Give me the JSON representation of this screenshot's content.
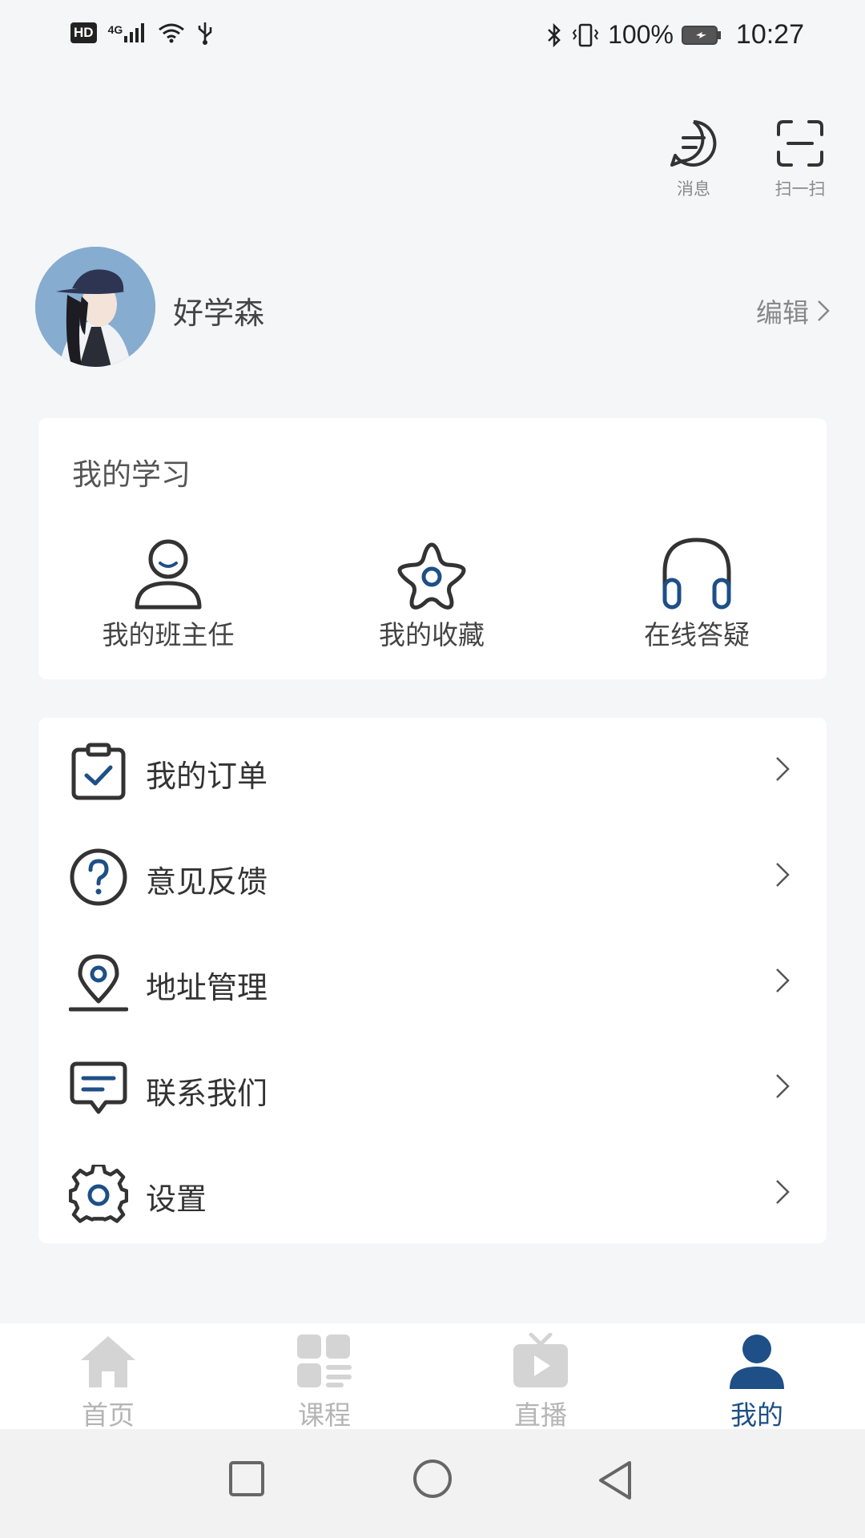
{
  "status_bar": {
    "hd": "HD",
    "network": "4G",
    "battery_percent": "100%",
    "time": "10:27"
  },
  "top_actions": {
    "message_label": "消息",
    "scan_label": "扫一扫"
  },
  "profile": {
    "username": "好学森",
    "edit_label": "编辑"
  },
  "my_study": {
    "title": "我的学习",
    "items": [
      {
        "label": "我的班主任",
        "icon": "person-icon"
      },
      {
        "label": "我的收藏",
        "icon": "star-icon"
      },
      {
        "label": "在线答疑",
        "icon": "headphones-icon"
      }
    ]
  },
  "menu": {
    "items": [
      {
        "label": "我的订单",
        "icon": "clipboard-check-icon"
      },
      {
        "label": "意见反馈",
        "icon": "question-circle-icon"
      },
      {
        "label": "地址管理",
        "icon": "location-pin-icon"
      },
      {
        "label": "联系我们",
        "icon": "chat-bubble-icon"
      },
      {
        "label": "设置",
        "icon": "gear-icon"
      }
    ]
  },
  "tab_bar": {
    "tabs": [
      {
        "label": "首页",
        "icon": "home-icon",
        "active": false
      },
      {
        "label": "课程",
        "icon": "grid-list-icon",
        "active": false
      },
      {
        "label": "直播",
        "icon": "tv-play-icon",
        "active": false
      },
      {
        "label": "我的",
        "icon": "user-icon",
        "active": true
      }
    ]
  },
  "colors": {
    "accent": "#1e4f87",
    "inactive_tab": "#b5b5b5",
    "background": "#f5f6f8",
    "card": "#ffffff"
  }
}
